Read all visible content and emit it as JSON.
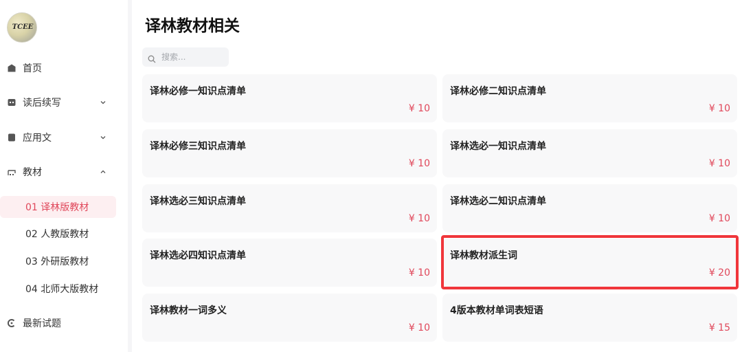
{
  "sidebar": {
    "logo_text": "TCEE",
    "items": [
      {
        "label": "首页"
      },
      {
        "label": "读后续写"
      },
      {
        "label": "应用文"
      },
      {
        "label": "教材"
      }
    ],
    "sub_items": [
      {
        "label": "01 译林版教材"
      },
      {
        "label": "02 人教版教材"
      },
      {
        "label": "03 外研版教材"
      },
      {
        "label": "04 北师大版教材"
      }
    ],
    "latest": {
      "label": "最新试题"
    }
  },
  "main": {
    "title": "译林教材相关",
    "search_placeholder": "搜索...",
    "cards": [
      {
        "title": "译林必修一知识点清单",
        "price": "¥ 10"
      },
      {
        "title": "译林必修二知识点清单",
        "price": "¥ 10"
      },
      {
        "title": "译林必修三知识点清单",
        "price": "¥ 10"
      },
      {
        "title": "译林选必一知识点清单",
        "price": "¥ 10"
      },
      {
        "title": "译林选必三知识点清单",
        "price": "¥ 10"
      },
      {
        "title": "译林选必二知识点清单",
        "price": "¥ 10"
      },
      {
        "title": "译林选必四知识点清单",
        "price": "¥ 10"
      },
      {
        "title": "译林教材派生词",
        "price": "¥ 20"
      },
      {
        "title": "译林教材一词多义",
        "price": "¥ 10"
      },
      {
        "title": "4版本教材单词表短语",
        "price": "¥ 15"
      }
    ]
  },
  "colors": {
    "accent": "#e0475a",
    "active_bg": "#fdeff1",
    "card_bg": "#f8f8f9",
    "highlight": "#f0363b"
  }
}
